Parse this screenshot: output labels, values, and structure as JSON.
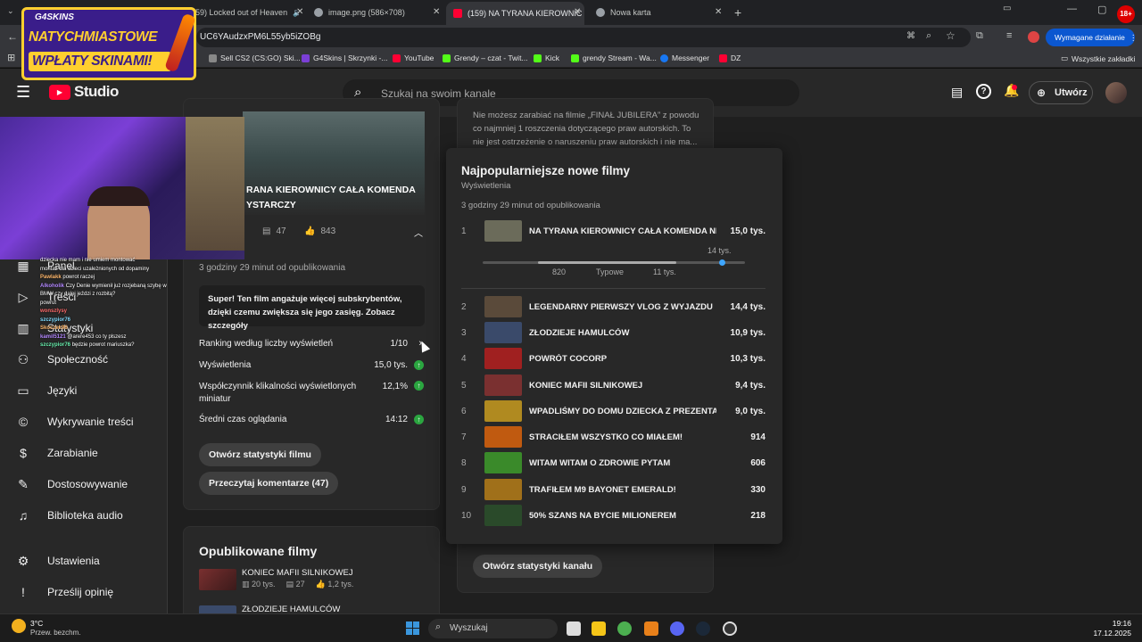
{
  "browser": {
    "tabs": [
      {
        "label": "(159) Locked out of Heaven",
        "fav_color": "#ff0033"
      },
      {
        "label": "image.png (586×708)",
        "fav_color": "#9aa0a6"
      },
      {
        "label": "(159) NA TYRANA KIEROWNIC",
        "fav_color": "#ff0033"
      },
      {
        "label": "Nowa karta",
        "fav_color": "#9aa0a6"
      }
    ],
    "url": "UC6YAudzxPM6L55yb5iZOBg",
    "action_label": "Wymagane działanie",
    "bookmarks": [
      {
        "label": "Sell CS2 (CS:GO) Ski...",
        "color": "#888888"
      },
      {
        "label": "G4Skins | Skrzynki -...",
        "color": "#7b3fd6"
      },
      {
        "label": "YouTube",
        "color": "#ff0033"
      },
      {
        "label": "Grendy – czat - Twit...",
        "color": "#53fc18"
      },
      {
        "label": "Kick",
        "color": "#53fc18"
      },
      {
        "label": "grendy Stream - Wa...",
        "color": "#53fc18"
      },
      {
        "label": "Messenger",
        "color": "#1877f2"
      },
      {
        "label": "DZ",
        "color": "#ff0033"
      }
    ],
    "all_bookmarks": "Wszystkie zakładki"
  },
  "banner": {
    "brand": "G4SKINS",
    "line1": "NATYCHMIASTOWE",
    "line2": "WPŁATY SKINAMI!"
  },
  "studio": {
    "logo": "Studio",
    "search_placeholder": "Szukaj na swoim kanale",
    "create_label": "Utwórz"
  },
  "sidebar": {
    "items": [
      {
        "label": "Panel",
        "icon": "dashboard-icon",
        "glyph": "▦"
      },
      {
        "label": "Treści",
        "icon": "content-icon",
        "glyph": "▷"
      },
      {
        "label": "Statystyki",
        "icon": "analytics-icon",
        "glyph": "▥"
      },
      {
        "label": "Społeczność",
        "icon": "community-icon",
        "glyph": "⚇"
      },
      {
        "label": "Języki",
        "icon": "subtitles-icon",
        "glyph": "▭"
      },
      {
        "label": "Wykrywanie treści",
        "icon": "copyright-icon",
        "glyph": "©"
      },
      {
        "label": "Zarabianie",
        "icon": "earn-icon",
        "glyph": "$"
      },
      {
        "label": "Dostosowywanie",
        "icon": "customize-icon",
        "glyph": "✎"
      },
      {
        "label": "Biblioteka audio",
        "icon": "audio-library-icon",
        "glyph": "♫"
      },
      {
        "label": "Ustawienia",
        "icon": "settings-icon",
        "glyph": "⚙"
      },
      {
        "label": "Prześlij opinię",
        "icon": "feedback-icon",
        "glyph": "!"
      }
    ]
  },
  "latest_video": {
    "thumb_title": "RANA KIEROWNICY CAŁA KOMENDA",
    "thumb_title2": "YSTARCZY",
    "comments": "47",
    "likes": "843",
    "published": "3 godziny 29 minut od opublikowania",
    "tip": "Super! Ten film angażuje więcej subskrybentów, dzięki czemu zwiększa się jego zasięg. Zobacz szczegóły",
    "metrics": [
      {
        "label": "Ranking według liczby wyświetleń",
        "value": "1/10"
      },
      {
        "label": "Wyświetlenia",
        "value": "15,0 tys."
      },
      {
        "label": "Współczynnik klikalności wyświetlonych miniatur",
        "value": "12,1%"
      },
      {
        "label": "Średni czas oglądania",
        "value": "14:12"
      }
    ],
    "btn_stats": "Otwórz statystyki filmu",
    "btn_comments": "Przeczytaj komentarze (47)"
  },
  "published": {
    "title": "Opublikowane filmy",
    "items": [
      {
        "title": "KONIEC MAFII SILNIKOWEJ",
        "views": "20 tys.",
        "comments": "27",
        "likes": "1,2 tys."
      },
      {
        "title": "ZŁODZIEJE HAMULCÓW"
      }
    ]
  },
  "notice": {
    "line1": "Nie możesz zarabiać na filmie „FINAŁ JUBILERA” z powodu",
    "line2": "co najmniej 1 roszczenia dotyczącego praw autorskich. To",
    "line3": "nie jest ostrzeżenie o naruszeniu praw autorskich i nie ma..."
  },
  "channel_btn": "Otwórz statystyki kanału",
  "popup": {
    "title": "Najpopularniejsze nowe filmy",
    "subtitle": "Wyświetlenia",
    "time": "3 godziny 29 minut od opublikowania",
    "typical": {
      "low": "820",
      "mid": "Typowe",
      "high": "11 tys.",
      "peak": "14 tys."
    },
    "rows": [
      {
        "rank": "1",
        "title": "NA TYRANA KIEROWNICY CAŁA KOMENDA NIE...",
        "views": "15,0 tys.",
        "thumb": "#6b6b5a"
      },
      {
        "rank": "2",
        "title": "LEGENDARNY PIERWSZY VLOG Z WYJAZDU",
        "views": "14,4 tys.",
        "thumb": "#5a4a3a"
      },
      {
        "rank": "3",
        "title": "ZŁODZIEJE HAMULCÓW",
        "views": "10,9 tys.",
        "thumb": "#3a4a6a"
      },
      {
        "rank": "4",
        "title": "POWRÓT COCORP",
        "views": "10,3 tys.",
        "thumb": "#a02020"
      },
      {
        "rank": "5",
        "title": "KONIEC MAFII SILNIKOWEJ",
        "views": "9,4 tys.",
        "thumb": "#7a3030"
      },
      {
        "rank": "6",
        "title": "WPADLIŚMY DO DOMU DZIECKA Z PREZENTAMI",
        "views": "9,0 tys.",
        "thumb": "#b08a20"
      },
      {
        "rank": "7",
        "title": "STRACIŁEM WSZYSTKO CO MIAŁEM!",
        "views": "914",
        "thumb": "#c05a10"
      },
      {
        "rank": "8",
        "title": "WITAM WITAM O ZDROWIE PYTAM",
        "views": "606",
        "thumb": "#3a8a2a"
      },
      {
        "rank": "9",
        "title": "TRAFIŁEM M9 BAYONET EMERALD!",
        "views": "330",
        "thumb": "#a0701a"
      },
      {
        "rank": "10",
        "title": "50% SZANS NA BYCIE MILIONEREM",
        "views": "218",
        "thumb": "#2a4a2a"
      }
    ]
  },
  "chat": [
    {
      "user": "",
      "msg": "dziecka nie mam i nie umiem montować"
    },
    {
      "user": "",
      "msg": "montaż dla dzieci uzależnionych od dopaminy"
    },
    {
      "user": "Pawlakk",
      "msg": "powrot raczej"
    },
    {
      "user": "Alkoholik",
      "msg": "Czy Denie wymienił już rozjebaną szybę w"
    },
    {
      "user": "",
      "msg": "BMW czy dalej jeździ z rozbitą?"
    },
    {
      "user": "",
      "msg": "powrut"
    },
    {
      "user": "wonszlysy",
      "msg": ""
    },
    {
      "user": "szczypior76",
      "msg": ""
    },
    {
      "user": "Skoczek96",
      "msg": ""
    },
    {
      "user": "kamil5121",
      "msg": "@arere453 co ty plszesz"
    },
    {
      "user": "szczypior76",
      "msg": "będzie powrot mariuszka?"
    }
  ],
  "taskbar": {
    "weather": "3°C",
    "weather_desc": "Przew. bezchm.",
    "search": "Wyszukaj",
    "time": "19:16",
    "date": "17.12.2025"
  }
}
